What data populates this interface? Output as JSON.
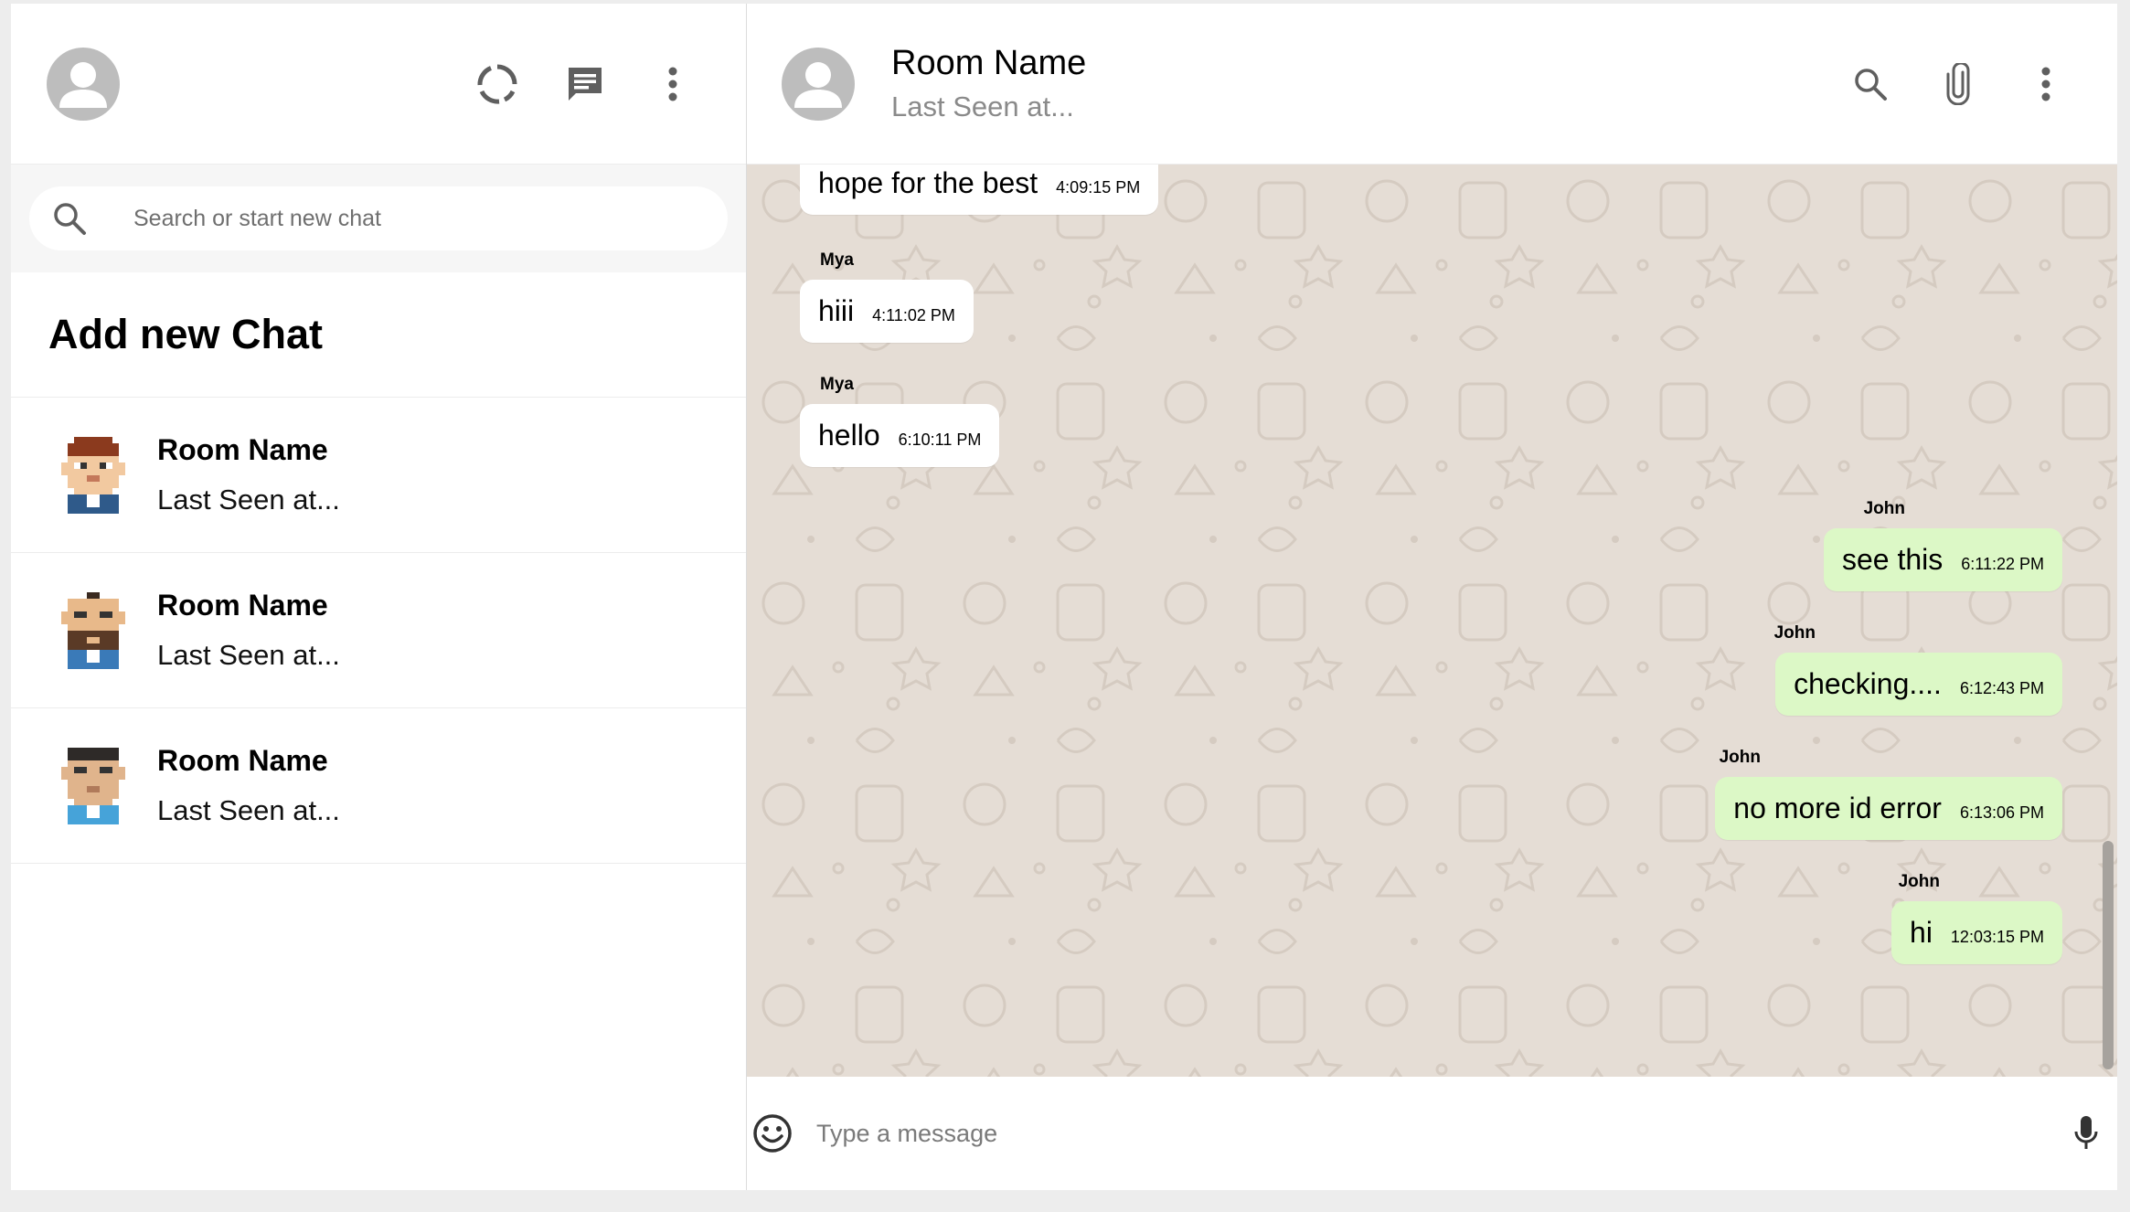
{
  "sidebar": {
    "search_placeholder": "Search or start new chat",
    "add_chat_label": "Add new Chat",
    "chats": [
      {
        "name": "Room Name",
        "last_seen": "Last Seen at...",
        "avatar": "pixel-avatar-brown-hair"
      },
      {
        "name": "Room Name",
        "last_seen": "Last Seen at...",
        "avatar": "pixel-avatar-bearded"
      },
      {
        "name": "Room Name",
        "last_seen": "Last Seen at...",
        "avatar": "pixel-avatar-dark-hair"
      }
    ]
  },
  "chat": {
    "header": {
      "title": "Room Name",
      "subtitle": "Last Seen at..."
    },
    "messages": [
      {
        "sender": "",
        "text": "hope for the best",
        "time": "4:09:15 PM",
        "mine": false
      },
      {
        "sender": "Mya",
        "text": "hiii",
        "time": "4:11:02 PM",
        "mine": false
      },
      {
        "sender": "Mya",
        "text": "hello",
        "time": "6:10:11 PM",
        "mine": false
      },
      {
        "sender": "John",
        "text": "see this",
        "time": "6:11:22 PM",
        "mine": true
      },
      {
        "sender": "John",
        "text": "checking....",
        "time": "6:12:43 PM",
        "mine": true
      },
      {
        "sender": "John",
        "text": "no more id error",
        "time": "6:13:06 PM",
        "mine": true
      },
      {
        "sender": "John",
        "text": "hi",
        "time": "12:03:15 PM",
        "mine": true
      }
    ],
    "input_placeholder": "Type a message"
  },
  "colors": {
    "chat_background": "#e5ddd5",
    "own_bubble": "#dcf8c6",
    "other_bubble": "#ffffff",
    "icon_gray": "#6b6b6b"
  }
}
